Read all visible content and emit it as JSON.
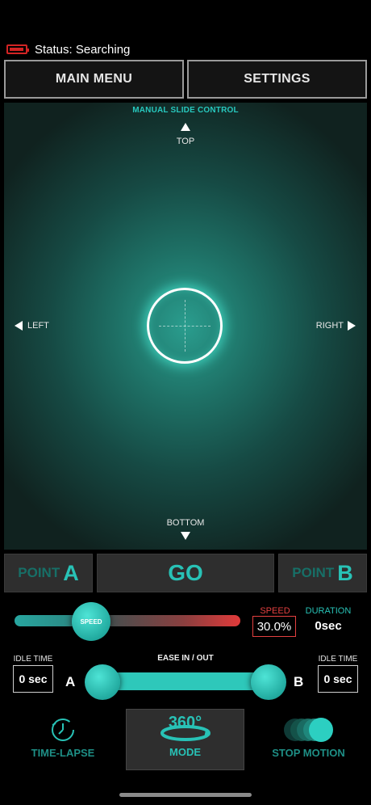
{
  "status": {
    "label": "Status: Searching",
    "battery_color": "#d32424"
  },
  "top_nav": {
    "main_menu": "MAIN MENU",
    "settings": "SETTINGS"
  },
  "pad": {
    "title": "MANUAL SLIDE CONTROL",
    "top": "TOP",
    "bottom": "BOTTOM",
    "left": "LEFT",
    "right": "RIGHT",
    "accent": "#27c8be"
  },
  "points": {
    "point_a_word": "POINT",
    "point_a_letter": "A",
    "go": "GO",
    "point_b_word": "POINT",
    "point_b_letter": "B"
  },
  "speed": {
    "knob_label": "SPEED",
    "label": "SPEED",
    "value": "30.0%",
    "level": 0.3
  },
  "duration": {
    "label": "DURATION",
    "value": "0sec"
  },
  "idle": {
    "left_label": "IDLE TIME",
    "left_value": "0 sec",
    "right_label": "IDLE TIME",
    "right_value": "0 sec"
  },
  "ease": {
    "label": "EASE IN / OUT",
    "a": "A",
    "b": "B"
  },
  "modes": {
    "timelapse": "TIME-LAPSE",
    "mode_360_badge": "360°",
    "mode_360": "MODE",
    "stop_motion": "STOP MOTION"
  }
}
